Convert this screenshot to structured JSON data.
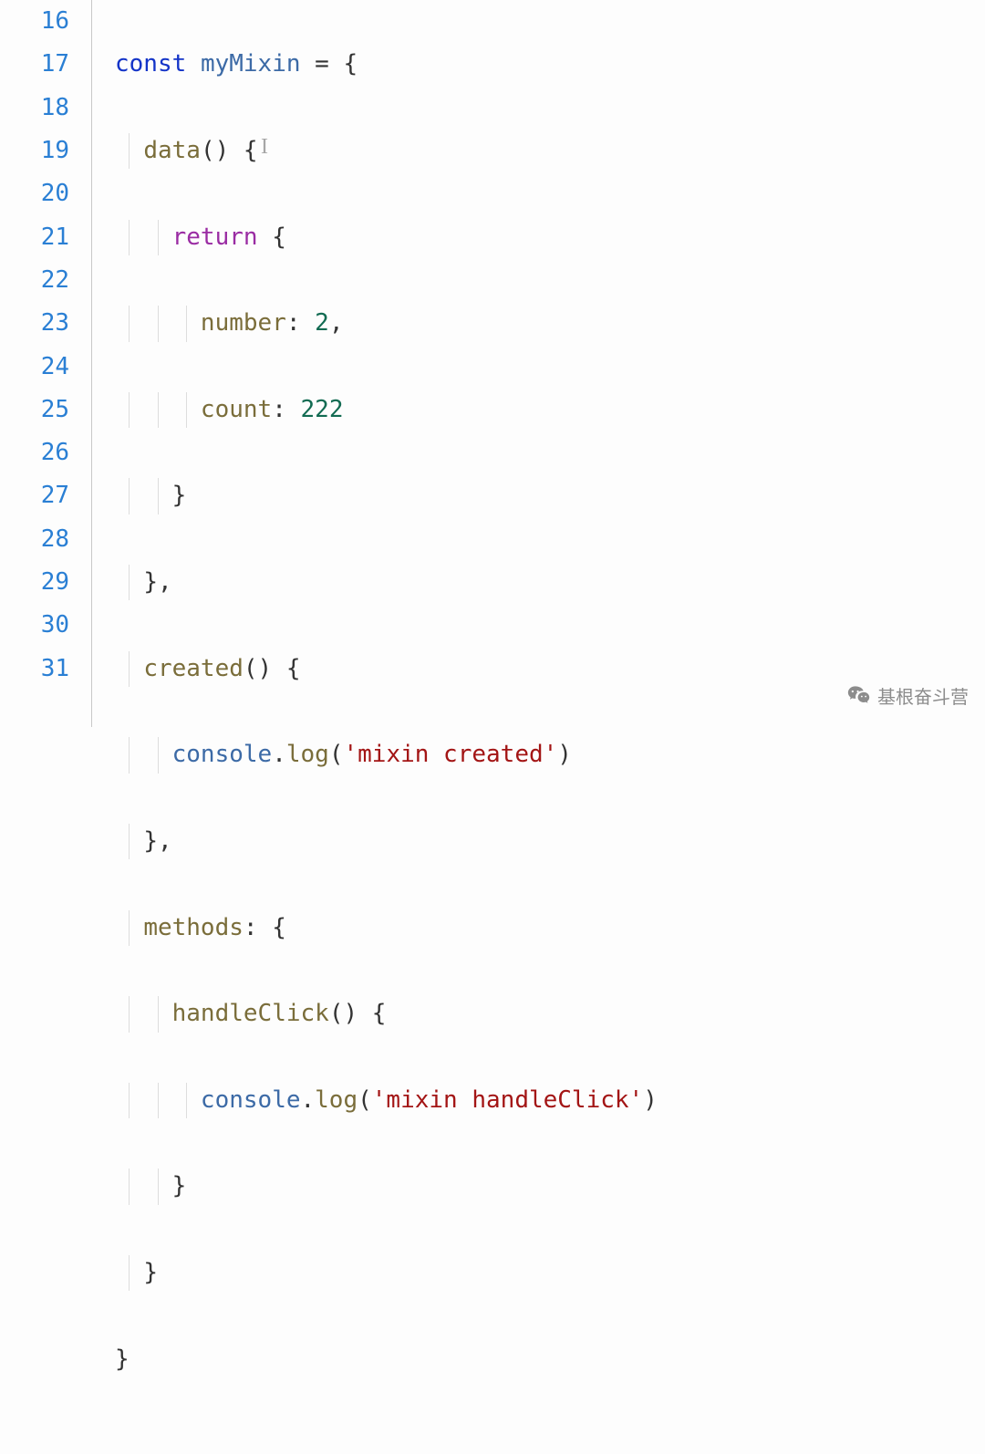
{
  "gutter": {
    "start": 16,
    "lines": [
      "16",
      "17",
      "18",
      "19",
      "20",
      "21",
      "22",
      "23",
      "24",
      "25",
      "26",
      "27",
      "28",
      "29",
      "30",
      "31"
    ]
  },
  "code": {
    "l16": {
      "kw": "const",
      "ident": "myMixin",
      "eq": " = {",
      "sp": ""
    },
    "l17": {
      "prop": "data",
      "rest": "() {"
    },
    "l18": {
      "ret": "return",
      "brace": " {"
    },
    "l19": {
      "key": "number",
      "colon": ": ",
      "val": "2",
      "comma": ","
    },
    "l20": {
      "key": "count",
      "colon": ": ",
      "val": "222"
    },
    "l21": {
      "brace": "}"
    },
    "l22": {
      "brace": "},"
    },
    "l23": {
      "prop": "created",
      "rest": "() {"
    },
    "l24": {
      "obj": "console",
      "dot": ".",
      "fn": "log",
      "open": "(",
      "str": "'mixin created'",
      "close": ")"
    },
    "l25": {
      "brace": "},"
    },
    "l26": {
      "prop": "methods",
      "rest": ": {"
    },
    "l27": {
      "prop": "handleClick",
      "rest": "() {"
    },
    "l28": {
      "obj": "console",
      "dot": ".",
      "fn": "log",
      "open": "(",
      "str": "'mixin handleClick'",
      "close": ")"
    },
    "l29": {
      "brace": "}"
    },
    "l30": {
      "brace": "}"
    },
    "l31": {
      "brace": "}"
    }
  },
  "watermark": {
    "text": "基根奋斗营"
  }
}
